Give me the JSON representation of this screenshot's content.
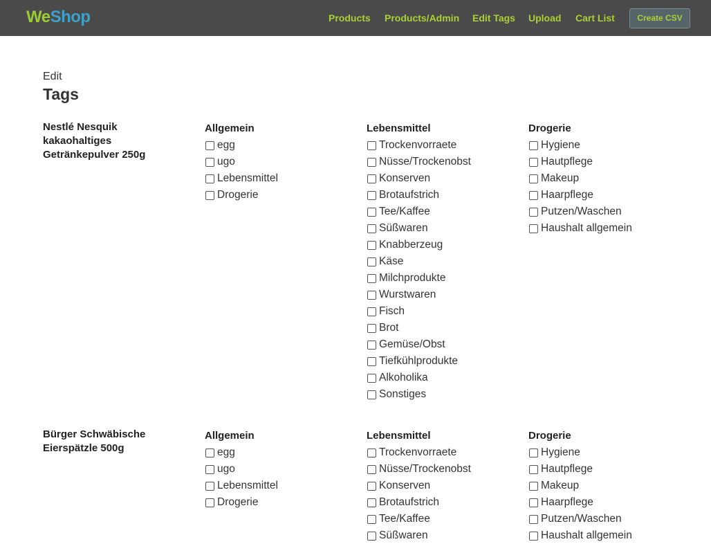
{
  "brand": {
    "part1": "We",
    "part2": "Shop"
  },
  "nav": {
    "links": [
      "Products",
      "Products/Admin",
      "Edit Tags",
      "Upload",
      "Cart List"
    ],
    "create_csv": "Create CSV"
  },
  "page": {
    "edit_label": "Edit",
    "title": "Tags"
  },
  "column_headers": [
    "Allgemein",
    "Lebensmittel",
    "Drogerie"
  ],
  "products": [
    {
      "name": "Nestlé Nesquik kakaohaltiges Getränkepulver 250g",
      "columns": [
        {
          "tags": [
            "egg",
            "ugo",
            "Lebensmittel",
            "Drogerie"
          ]
        },
        {
          "tags": [
            "Trockenvorraete",
            "Nüsse/Trockenobst",
            "Konserven",
            "Brotaufstrich",
            "Tee/Kaffee",
            "Süßwaren",
            "Knabberzeug",
            "Käse",
            "Milchprodukte",
            "Wurstwaren",
            "Fisch",
            "Brot",
            "Gemüse/Obst",
            "Tiefkühlprodukte",
            "Alkoholika",
            "Sonstiges"
          ]
        },
        {
          "tags": [
            "Hygiene",
            "Hautpflege",
            "Makeup",
            "Haarpflege",
            "Putzen/Waschen",
            "Haushalt allgemein"
          ]
        }
      ]
    },
    {
      "name": "Bürger Schwäbische Eierspätzle 500g",
      "columns": [
        {
          "tags": [
            "egg",
            "ugo",
            "Lebensmittel",
            "Drogerie"
          ]
        },
        {
          "tags": [
            "Trockenvorraete",
            "Nüsse/Trockenobst",
            "Konserven",
            "Brotaufstrich",
            "Tee/Kaffee",
            "Süßwaren"
          ]
        },
        {
          "tags": [
            "Hygiene",
            "Hautpflege",
            "Makeup",
            "Haarpflege",
            "Putzen/Waschen",
            "Haushalt allgemein"
          ]
        }
      ]
    }
  ]
}
